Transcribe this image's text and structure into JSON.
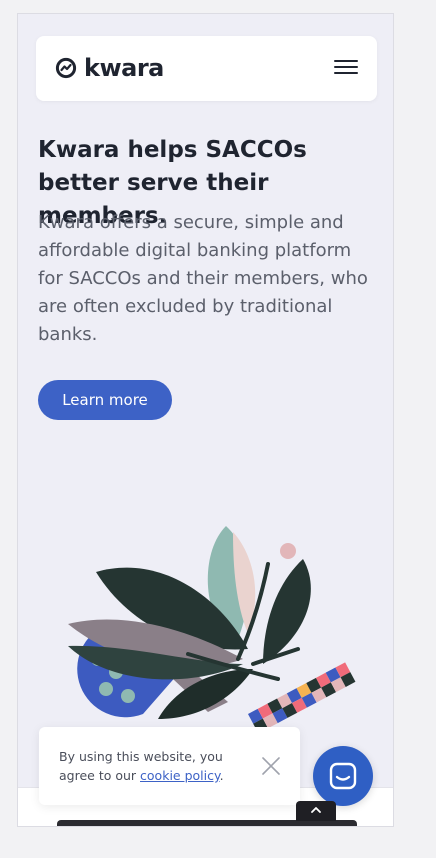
{
  "header": {
    "brand": "kwara",
    "menu_icon": "hamburger-menu-icon"
  },
  "hero": {
    "headline": "Kwara helps SACCOs better serve their members.",
    "lead": "Kwara offers a secure, simple and affordable digital banking platform for SACCOs and their members, who are often excluded by traditional banks.",
    "cta_label": "Learn more"
  },
  "illustration": {
    "name": "leaves-moon-illustration",
    "colors": {
      "moon": "#f6b352",
      "leaf_dark": "#253532",
      "leaf_teal": "#8fb9b1",
      "leaf_blush": "#ead3cf",
      "blue": "#3d5bc0",
      "pink": "#f06b7a",
      "mauve": "#8a7f88"
    }
  },
  "cookie": {
    "text_before": "By using this website, you agree to our ",
    "link": "cookie policy",
    "text_after": ".",
    "close_icon": "close-icon"
  },
  "chat": {
    "icon": "chat-icon"
  },
  "scroll_top": {
    "icon": "chevron-up-icon"
  },
  "colors": {
    "accent": "#3d62c6",
    "page_bg": "#eeeef6",
    "text": "#1f2430",
    "muted_text": "#5b5f6b"
  }
}
